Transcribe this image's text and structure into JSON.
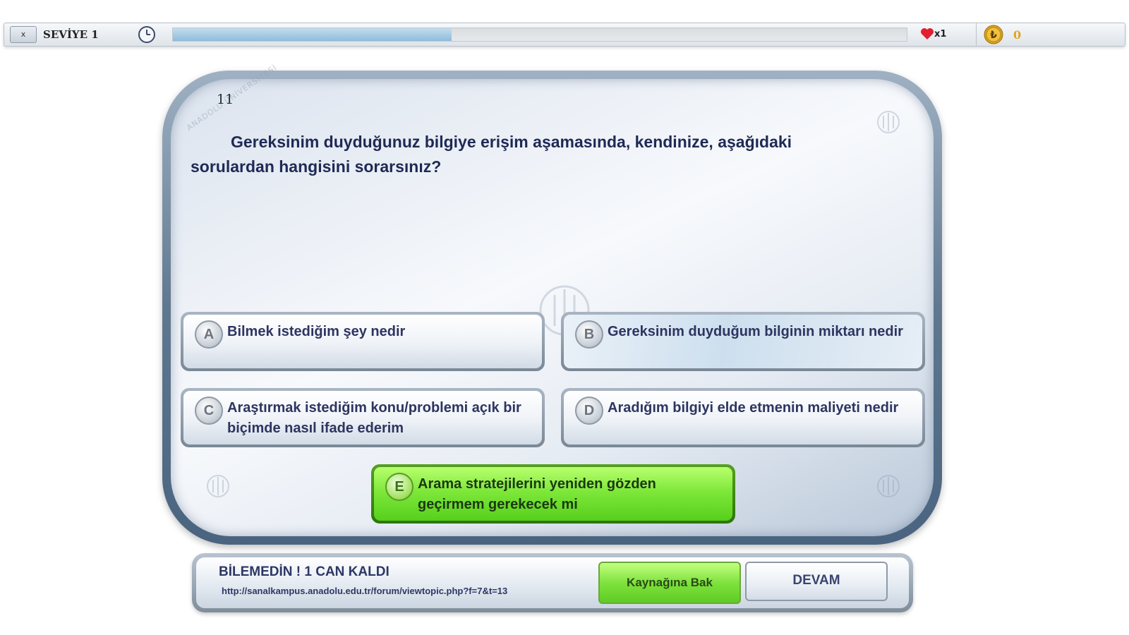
{
  "topbar": {
    "close_label": "x",
    "level_label": "SEVİYE 1",
    "progress_fraction": 0.38,
    "lives_count": "x1",
    "coins": "0",
    "colors": {
      "heart": "#e0202e",
      "coin": "#e0a420",
      "progress": "#8fbcdc"
    }
  },
  "question": {
    "number": "11",
    "watermark": "ANADOLU ÜNİVERSİTESİ",
    "text": "Gereksinim duyduğunuz bilgiye erişim aşamasında, kendinize, aşağıdaki sorulardan hangisini sorarsınız?"
  },
  "answers": [
    {
      "letter": "A",
      "text": "Bilmek istediğim şey nedir"
    },
    {
      "letter": "B",
      "text": "Gereksinim duyduğum bilginin miktarı nedir"
    },
    {
      "letter": "C",
      "text": "Araştırmak istediğim konu/problemi açık bir biçimde nasıl ifade ederim"
    },
    {
      "letter": "D",
      "text": "Aradığım bilgiyi elde etmenin maliyeti nedir"
    },
    {
      "letter": "E",
      "text": "Arama stratejilerini yeniden gözden geçirmem gerekecek mi",
      "selected": true
    }
  ],
  "feedback": {
    "title": "BİLEMEDİN ! 1 CAN KALDI",
    "link": "http://sanalkampus.anadolu.edu.tr/forum/viewtopic.php?f=7&t=13",
    "source_button": "Kaynağına Bak",
    "continue_button": "DEVAM"
  }
}
